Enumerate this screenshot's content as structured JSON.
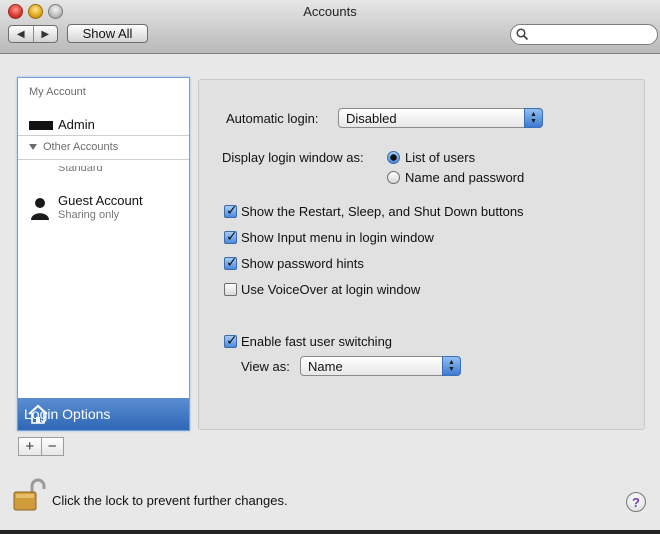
{
  "window": {
    "title": "Accounts"
  },
  "toolbar": {
    "back_label": "◀",
    "forward_label": "▶",
    "show_all_label": "Show All",
    "search_placeholder": ""
  },
  "sidebar": {
    "my_account_header": "My Account",
    "admin_label": "Admin",
    "other_accounts_header": "Other Accounts",
    "standard_label": "Standard",
    "guest_name": "Guest Account",
    "guest_sub": "Sharing only",
    "login_options_label": "Login Options",
    "add_label": "+",
    "remove_label": "−"
  },
  "login_options": {
    "automatic_login_label": "Automatic login:",
    "automatic_login_value": "Disabled",
    "display_as_label": "Display login window as:",
    "radio_list_users": "List of users",
    "radio_name_password": "Name and password",
    "selected_display": "List of users",
    "cb_restart": "Show the Restart, Sleep, and Shut Down buttons",
    "cb_input_menu": "Show Input menu in login window",
    "cb_password_hints": "Show password hints",
    "cb_voiceover": "Use VoiceOver at login window",
    "cb_fast_switching": "Enable fast user switching",
    "view_as_label": "View as:",
    "view_as_value": "Name",
    "checked": {
      "restart": true,
      "input_menu": true,
      "password_hints": true,
      "voiceover": false,
      "fast_switching": true
    }
  },
  "footer": {
    "lock_text": "Click the lock to prevent further changes.",
    "help_label": "?"
  },
  "colors": {
    "selection": "#3a73c2",
    "accent": "#4d8bde"
  }
}
